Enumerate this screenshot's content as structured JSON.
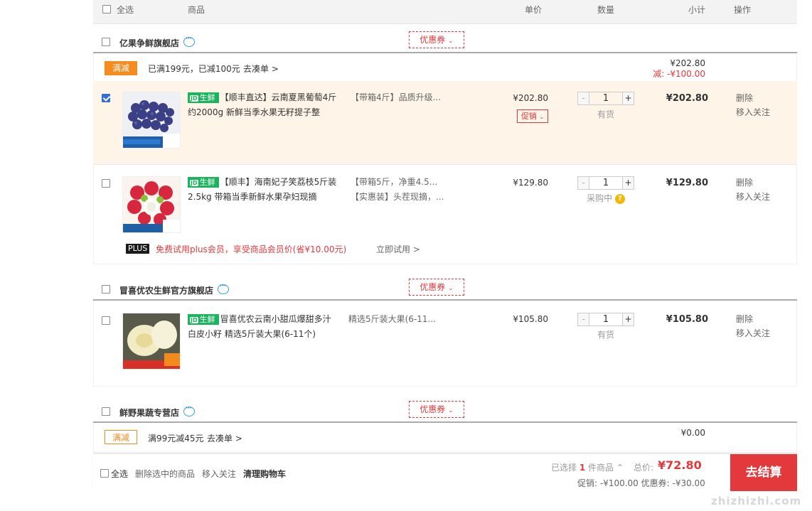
{
  "header": {
    "select_all": "全选",
    "product": "商品",
    "unit_price": "单价",
    "quantity": "数量",
    "subtotal": "小计",
    "action": "操作"
  },
  "shops": [
    {
      "name": "亿果争鲜旗舰店",
      "coupon": "优惠券",
      "promo_tag": "满减",
      "promo_text": "已满199元，已减100元",
      "promo_link": "去凑单 >",
      "sum_total": "¥202.80",
      "sum_minus": "减: -¥100.00",
      "items": [
        {
          "checked": true,
          "fresh_label": "生鲜",
          "title": "【顺丰直达】云南夏黑葡萄4斤 约2000g 新鲜当季水果无籽提子整",
          "spec": "【带箱4斤】品质升级...",
          "price": "¥202.80",
          "promo_btn": "促销",
          "qty": "1",
          "stock": "有货",
          "subtotal": "¥202.80",
          "op_delete": "删除",
          "op_follow": "移入关注"
        },
        {
          "checked": false,
          "fresh_label": "生鲜",
          "title": "【顺丰】海南妃子笑荔枝5斤装 2.5kg 带箱当季新鲜水果孕妇现摘",
          "spec": "【带箱5斤，净重4.5...",
          "spec2": "【实惠装】头茬现摘，...",
          "price": "¥129.80",
          "qty": "1",
          "stock": "采购中",
          "subtotal": "¥129.80",
          "op_delete": "删除",
          "op_follow": "移入关注",
          "plus_badge": "PLUS",
          "plus_text": "免费试用plus会员，享受商品会员价(省¥10.00元)",
          "plus_link": "立即试用 >"
        }
      ]
    },
    {
      "name": "冒喜优农生鲜官方旗舰店",
      "coupon": "优惠券",
      "items": [
        {
          "checked": false,
          "fresh_label": "生鲜",
          "title": "冒喜优农云南小甜瓜爆甜多汁白皮小籽 精选5斤装大果(6-11个)",
          "spec": "精选5斤装大果(6-11...",
          "price": "¥105.80",
          "qty": "1",
          "stock": "有货",
          "subtotal": "¥105.80",
          "op_delete": "删除",
          "op_follow": "移入关注"
        }
      ]
    },
    {
      "name": "鲜野果蔬专营店",
      "coupon": "优惠券",
      "promo_tag": "满减",
      "promo_text": "满99元减45元",
      "promo_link": "去凑单 >",
      "sum_total": "¥0.00"
    }
  ],
  "footer": {
    "select_all": "全选",
    "delete_selected": "删除选中的商品",
    "move_follow": "移入关注",
    "clear_cart": "清理购物车",
    "selected_prefix": "已选择",
    "selected_count": "1",
    "selected_suffix": "件商品",
    "total_label": "总价:",
    "total_value": "¥72.80",
    "promo_line": "促销: -¥100.00  优惠券: -¥30.00",
    "checkout": "去结算"
  },
  "watermark": "zhizhizhi.com",
  "colors": {
    "accent_red": "#e4393c",
    "orange": "#f78b1e",
    "fresh_green": "#19b45b",
    "selected_row_bg": "#fff4e8"
  }
}
